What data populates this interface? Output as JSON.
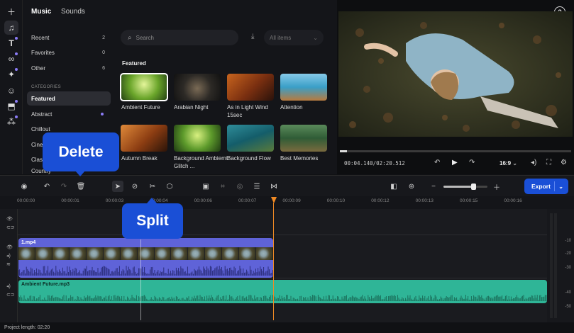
{
  "rail": {
    "icons": [
      "plus-icon",
      "music-icon",
      "text-icon",
      "transition-icon",
      "effects-icon",
      "sticker-icon",
      "adjust-icon",
      "apps-icon"
    ]
  },
  "library": {
    "tabs": [
      "Music",
      "Sounds"
    ],
    "sidebar": [
      {
        "label": "Recent",
        "count": "2"
      },
      {
        "label": "Favorites",
        "count": "0"
      },
      {
        "label": "Other",
        "count": "6"
      }
    ],
    "categories_label": "CATEGORIES",
    "categories": [
      "Featured",
      "Abstract",
      "Chillout",
      "Cinematic",
      "Classical",
      "Country"
    ],
    "search_placeholder": "Search",
    "filter_label": "All items",
    "section_title": "Featured",
    "tracks": [
      {
        "label": "Ambient Future",
        "selected": true
      },
      {
        "label": "Arabian Night"
      },
      {
        "label": "As in Light Wind 15sec"
      },
      {
        "label": "Attention"
      },
      {
        "label": "Autumn Break"
      },
      {
        "label": "Background Ambiemt Glitch ..."
      },
      {
        "label": "Background Flow"
      },
      {
        "label": "Best Memories"
      }
    ]
  },
  "player": {
    "timecode": "00:04.140/02:20.512",
    "aspect": "16:9",
    "help": "?"
  },
  "toolbar": {
    "export_label": "Export",
    "zoom_progress": 0.68
  },
  "ruler": [
    "00:00:00",
    "00:00:01",
    "00:00:03",
    "00:00:04",
    "00:00:06",
    "00:00:07",
    "00:00:09",
    "00:00:10",
    "00:00:12",
    "00:00:13",
    "00:00:15",
    "00:00:16"
  ],
  "clips": {
    "video": "1.mp4",
    "audio": "Ambient Future.mp3"
  },
  "db_scale": [
    "-10",
    "-20",
    "-30",
    "-40",
    "-50"
  ],
  "status": "Project length: 02:20",
  "callouts": {
    "delete": "Delete",
    "split": "Split"
  },
  "colors": {
    "accent": "#1a4fd6",
    "video_clip": "#5f63d8",
    "audio_clip": "#2fb597",
    "playhead": "#f08a24"
  }
}
